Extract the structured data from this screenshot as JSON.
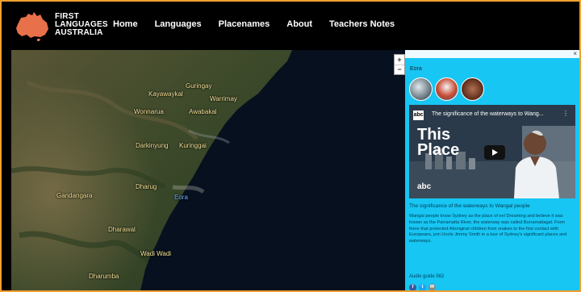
{
  "brand": {
    "line1": "FIRST",
    "line2": "LANGUAGES",
    "line3": "AUSTRALIA"
  },
  "nav": [
    "Home",
    "Languages",
    "Placenames",
    "About",
    "Teachers Notes"
  ],
  "map": {
    "zoom_in": "+",
    "zoom_out": "−",
    "places": [
      {
        "name": "Guringay"
      },
      {
        "name": "Kayawaykal"
      },
      {
        "name": "Warrimay"
      },
      {
        "name": "Wonnarua"
      },
      {
        "name": "Awabakal"
      },
      {
        "name": "Darkinyung"
      },
      {
        "name": "Kuringgai"
      },
      {
        "name": "Dharug"
      },
      {
        "name": "Eora"
      },
      {
        "name": "Gandangara"
      },
      {
        "name": "Dharawal"
      },
      {
        "name": "Wadi Wadi"
      },
      {
        "name": "Dharumba"
      }
    ]
  },
  "panel": {
    "close": "×",
    "language": "Eora",
    "video": {
      "logo": "abc",
      "title": "The significance of the waterways to Wang...",
      "menu": "⋮",
      "overlay_line1": "This",
      "overlay_line2": "Place",
      "watermark": "abc"
    },
    "caption": "The significance of the waterways to Wangal people",
    "description": "Wangal people know Sydney as the place of eel Dreaming and believe it was known as the Parramatta River, the waterway was called Burramattagal. From there that protected Aboriginal children from snakes to the first contact with Europeans, join Uncle Jimmy Smith in a tour of Sydney's significant places and waterways.",
    "audio_label": "Audio guide 562",
    "social": [
      "f",
      "t",
      "✉"
    ]
  },
  "colors": {
    "panel_bg": "#17c6f3",
    "header_bg": "#000000",
    "frame_border": "#f0a030",
    "place_label": "#f5e39a"
  }
}
